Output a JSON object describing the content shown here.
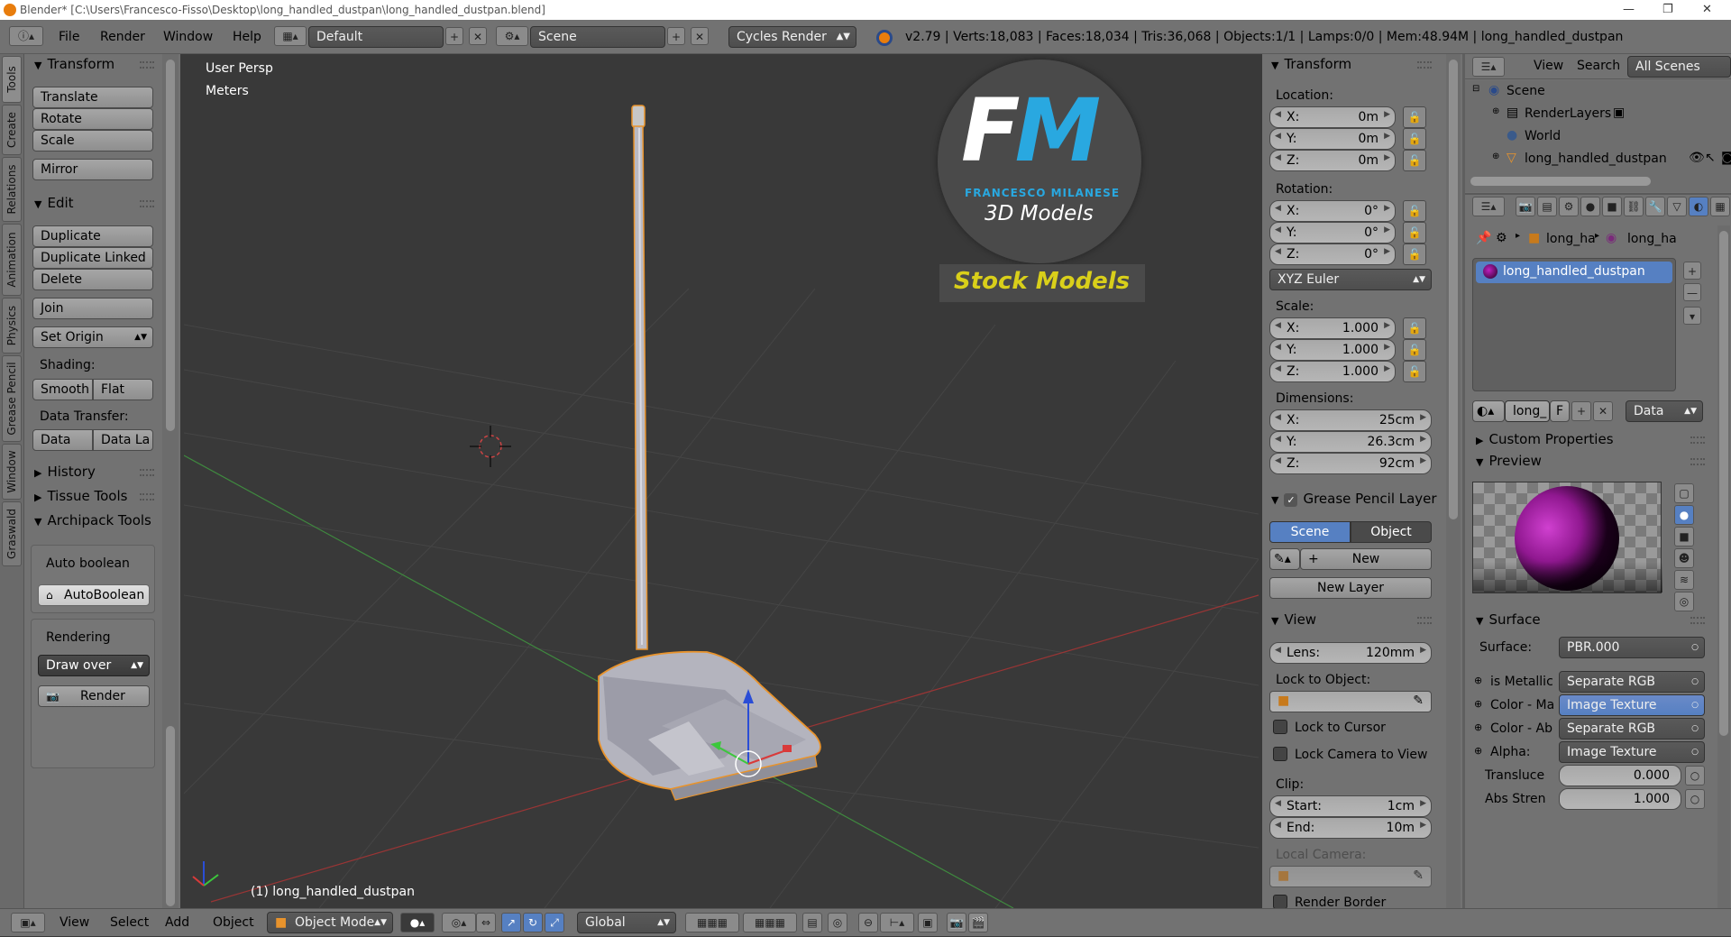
{
  "window": {
    "title": "Blender* [C:\\Users\\Francesco-Fisso\\Desktop\\long_handled_dustpan\\long_handled_dustpan.blend]"
  },
  "infobar": {
    "menus": [
      "File",
      "Render",
      "Window",
      "Help"
    ],
    "layout_name": "Default",
    "scene_name": "Scene",
    "render_engine": "Cycles Render",
    "stats": "v2.79 | Verts:18,083 | Faces:18,034 | Tris:36,068 | Objects:1/1 | Lamps:0/0 | Mem:48.94M | long_handled_dustpan"
  },
  "tool_tabs": [
    "Tools",
    "Create",
    "Relations",
    "Animation",
    "Physics",
    "Grease Pencil",
    "Window",
    "Graswald"
  ],
  "toolshelf": {
    "transform_header": "Transform",
    "translate": "Translate",
    "rotate": "Rotate",
    "scale": "Scale",
    "mirror": "Mirror",
    "edit_header": "Edit",
    "duplicate": "Duplicate",
    "duplicate_linked": "Duplicate Linked",
    "delete": "Delete",
    "join": "Join",
    "set_origin": "Set Origin",
    "shading_label": "Shading:",
    "smooth": "Smooth",
    "flat": "Flat",
    "data_transfer_label": "Data Transfer:",
    "data": "Data",
    "data_la": "Data La",
    "history_header": "History",
    "tissue_header": "Tissue Tools",
    "archipack_header": "Archipack Tools",
    "auto_boolean_label": "Auto boolean",
    "auto_boolean_btn": "AutoBoolean",
    "rendering_label": "Rendering",
    "draw_over": "Draw over",
    "render_btn": "Render"
  },
  "viewport": {
    "view_name": "User Persp",
    "units": "Meters",
    "object_label": "(1) long_handled_dustpan",
    "logo_letters": "FM",
    "logo_name": "FRANCESCO MILANESE",
    "logo_sub": "3D Models",
    "stock_label": "Stock Models"
  },
  "properties_n": {
    "transform_header": "Transform",
    "location_label": "Location:",
    "location": [
      {
        "axis": "X:",
        "value": "0m"
      },
      {
        "axis": "Y:",
        "value": "0m"
      },
      {
        "axis": "Z:",
        "value": "0m"
      }
    ],
    "rotation_label": "Rotation:",
    "rotation": [
      {
        "axis": "X:",
        "value": "0°"
      },
      {
        "axis": "Y:",
        "value": "0°"
      },
      {
        "axis": "Z:",
        "value": "0°"
      }
    ],
    "rotation_mode": "XYZ Euler",
    "scale_label": "Scale:",
    "scale": [
      {
        "axis": "X:",
        "value": "1.000"
      },
      {
        "axis": "Y:",
        "value": "1.000"
      },
      {
        "axis": "Z:",
        "value": "1.000"
      }
    ],
    "dimensions_label": "Dimensions:",
    "dimensions": [
      {
        "axis": "X:",
        "value": "25cm"
      },
      {
        "axis": "Y:",
        "value": "26.3cm"
      },
      {
        "axis": "Z:",
        "value": "92cm"
      }
    ],
    "grease_pencil_header": "Grease Pencil Layer",
    "scene_tab": "Scene",
    "object_tab": "Object",
    "new_btn": "New",
    "new_layer_btn": "New Layer",
    "view_header": "View",
    "lens_label": "Lens:",
    "lens_value": "120mm",
    "lock_to_object_label": "Lock to Object:",
    "lock_to_cursor": "Lock to Cursor",
    "lock_camera": "Lock Camera to View",
    "clip_label": "Clip:",
    "clip_start_label": "Start:",
    "clip_start": "1cm",
    "clip_end_label": "End:",
    "clip_end": "10m",
    "local_camera_label": "Local Camera:",
    "render_border": "Render Border"
  },
  "outliner": {
    "view_menu": "View",
    "search_menu": "Search",
    "scope": "All Scenes",
    "items": [
      "Scene",
      "RenderLayers",
      "World",
      "long_handled_dustpan"
    ]
  },
  "material": {
    "crumb1": "long_ha",
    "crumb2": "long_ha",
    "slot_name": "long_handled_dustpan",
    "mat_short": "long_",
    "mat_f": "F",
    "link": "Data",
    "custom_props_header": "Custom Properties",
    "preview_header": "Preview",
    "surface_header": "Surface",
    "surface_label": "Surface:",
    "surface_value": "PBR.000",
    "rows": [
      {
        "label": "is Metallic",
        "value": "Separate RGB"
      },
      {
        "label": "Color - Ma",
        "value": "Image Texture"
      },
      {
        "label": "Color - Ab",
        "value": "Separate RGB"
      },
      {
        "label": "Alpha:",
        "value": "Image Texture"
      }
    ],
    "translucent_label": "Transluce",
    "translucent_value": "0.000",
    "abs_label": "Abs Stren",
    "abs_value": "1.000"
  },
  "bottombar": {
    "menus": [
      "View",
      "Select",
      "Add",
      "Object"
    ],
    "mode": "Object Mode",
    "orientation": "Global"
  },
  "colors": {
    "panel": "#727272",
    "viewport": "#393939",
    "selection": "#5680c2",
    "accent_orange": "#e87d0d",
    "logo_blue": "#29a8e0",
    "stock_yellow": "#d9cf1a"
  }
}
